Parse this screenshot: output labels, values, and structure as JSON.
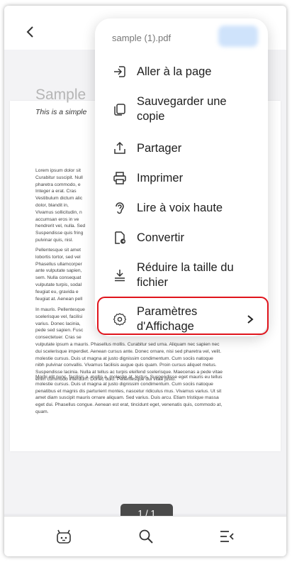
{
  "header": {
    "back_icon": "chevron-left-icon"
  },
  "document": {
    "title": "Sample",
    "subtitle": "This is a simple",
    "paragraphs": [
      [
        "Lorem ipsum dolor sit",
        "Curabitur suscipit. Null",
        "pharetra commodo, e",
        "Integer a erat. Cras",
        "Vestibulum dictum alic",
        "dolor, blandit in,",
        "Vivamus sollicitudin, n",
        "accumsan eros in ve",
        "hendrerit vel, nulla. Sed",
        "Suspendisse quis fring",
        "pulvinar quis, nisl."
      ],
      [
        "Pellentesque sit amet",
        "lobortis tortor, sed vel",
        "Phasellus ullamcorper",
        "ante vulputate sapien,",
        "sem. Nulla consequat",
        "vulputate turpis, sodal",
        "feugiat eu, gravida e",
        "feugiat at. Aenean pell"
      ],
      [
        "In mauris. Pellentesque",
        "scelerisque vel, facilisi",
        "varius. Donec lacinia,",
        "pede sed sapien. Fusc",
        "consectetuer. Cras se",
        "vulputate ipsum a mauris. Phasellus mollis. Curabitur sed urna. Aliquam nec sapien nec",
        "dui scelerisque imperdiet. Aenean cursus ante. Donec ornare, nisi sed pharetra vel, velit.",
        "molestie cursus. Duis ut magna at justo dignissim condimentum. Cum sociis natoque",
        "nibh pulvinar convallis. Vivamus facilisis augue quis quam. Proin cursus aliquet metus.",
        "Suspendisse lacinia. Nulla at tellus ac turpis eleifend scelerisque. Maecenas a pede vitae",
        "enim commodo interdum. Donec odio. Pellentesque dui vitae justo."
      ],
      [
        "Morbi elit nunc, facilisis a, mollis a, molestie at, lectus. Suspendisse eget mauris eu tellus",
        "molestie cursus. Duis ut magna at justo dignissim condimentum. Cum sociis natoque",
        "penatibus et magnis dis parturient montes, nascetur ridiculus mus. Vivamus varius. Ut sit",
        "amet diam suscipit mauris ornare aliquam. Sed varius. Duis arcu. Etiam tristique massa",
        "eget dui. Phasellus congue. Aenean est erat, tincidunt eget, venenatis quis, commodo at,",
        "quam."
      ]
    ]
  },
  "page_indicator": "1 / 1",
  "menu": {
    "title": "sample (1).pdf",
    "items": [
      {
        "label": "Aller à la page",
        "icon": "goto-page-icon"
      },
      {
        "label": "Sauvegarder une copie",
        "icon": "copy-icon"
      },
      {
        "label": "Partager",
        "icon": "share-icon"
      },
      {
        "label": "Imprimer",
        "icon": "printer-icon"
      },
      {
        "label": "Lire à voix haute",
        "icon": "ear-icon"
      },
      {
        "label": "Convertir",
        "icon": "convert-icon"
      },
      {
        "label": "Réduire la taille du fichier",
        "icon": "compress-icon"
      },
      {
        "label": "Paramètres d'Affichage",
        "icon": "gear-icon",
        "has_submenu": true,
        "highlighted": true
      }
    ]
  },
  "bottom_bar": [
    "ai-assistant-icon",
    "search-icon",
    "outline-menu-icon"
  ],
  "colors": {
    "highlight_border": "#e0141c",
    "page_indicator_bg": "#4a4a4a",
    "menu_bg": "#ffffff"
  }
}
